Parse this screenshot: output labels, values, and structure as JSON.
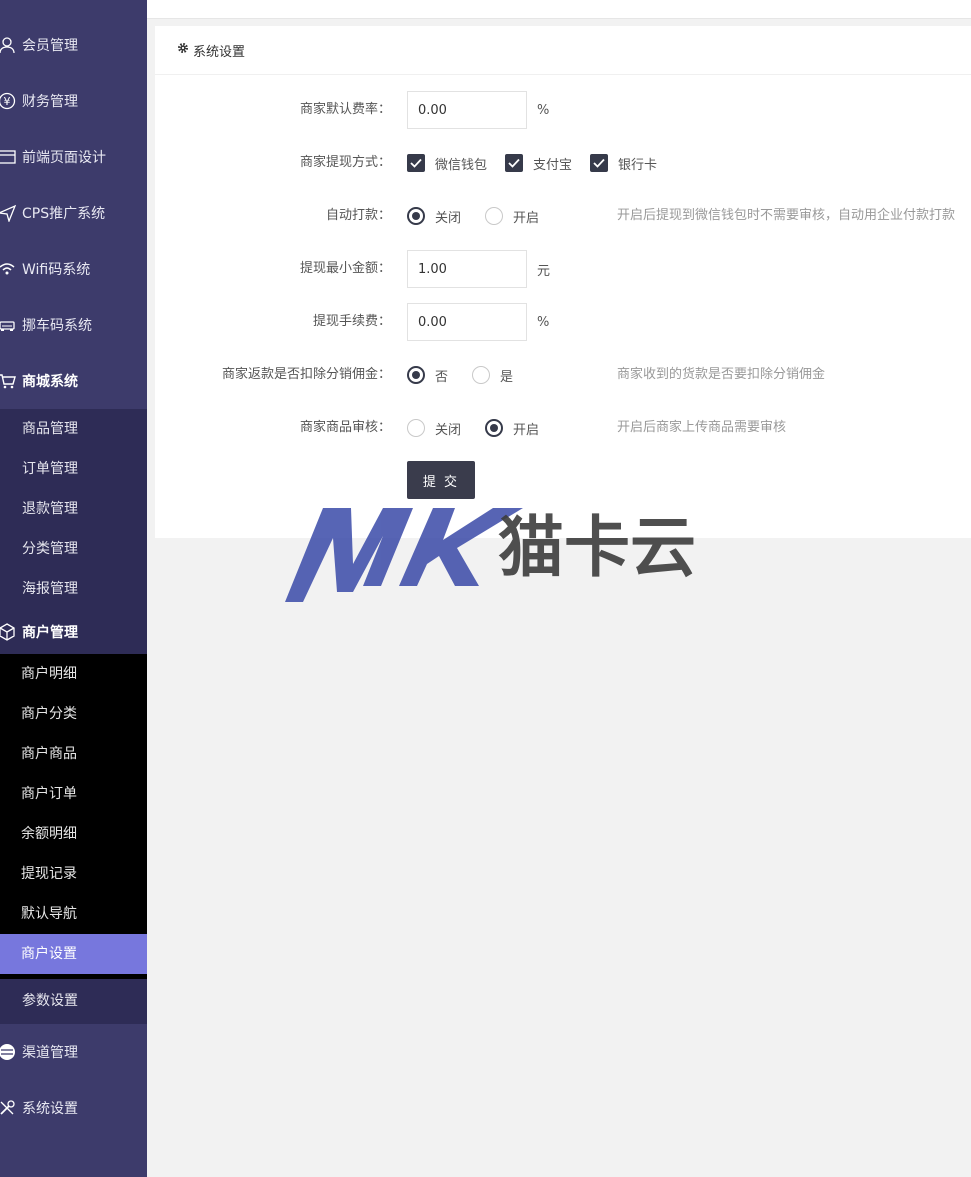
{
  "sidebar": {
    "items": [
      {
        "label": "会员管理",
        "icon": "user-icon"
      },
      {
        "label": "财务管理",
        "icon": "yen-icon"
      },
      {
        "label": "前端页面设计",
        "icon": "layout-icon"
      },
      {
        "label": "CPS推广系统",
        "icon": "send-icon"
      },
      {
        "label": "Wifi码系统",
        "icon": "wifi-icon"
      },
      {
        "label": "挪车码系统",
        "icon": "car-icon"
      },
      {
        "label": "商城系统",
        "icon": "cart-icon"
      }
    ],
    "mall_sub": [
      "商品管理",
      "订单管理",
      "退款管理",
      "分类管理",
      "海报管理"
    ],
    "merchant": {
      "label": "商户管理",
      "icon": "box-icon"
    },
    "merchant_sub": [
      "商户明细",
      "商户分类",
      "商户商品",
      "商户订单",
      "余额明细",
      "提现记录",
      "默认导航",
      "商户设置"
    ],
    "params": "参数设置",
    "bottom": [
      {
        "label": "渠道管理",
        "icon": "channel-icon"
      },
      {
        "label": "系统设置",
        "icon": "tools-icon"
      }
    ]
  },
  "card": {
    "title": "系统设置",
    "fields": {
      "fee_rate": {
        "label": "商家默认费率：",
        "value": "0.00",
        "unit": "%"
      },
      "withdraw_methods": {
        "label": "商家提现方式：",
        "options": [
          "微信钱包",
          "支付宝",
          "银行卡"
        ]
      },
      "auto_pay": {
        "label": "自动打款：",
        "options": [
          "关闭",
          "开启"
        ],
        "selected": "关闭",
        "hint": "开启后提现到微信钱包时不需要审核，自动用企业付款打款"
      },
      "min_amount": {
        "label": "提现最小金额：",
        "value": "1.00",
        "unit": "元"
      },
      "withdraw_fee": {
        "label": "提现手续费：",
        "value": "0.00",
        "unit": "%"
      },
      "deduct_commission": {
        "label": "商家返款是否扣除分销佣金：",
        "options": [
          "否",
          "是"
        ],
        "selected": "否",
        "hint": "商家收到的货款是否要扣除分销佣金"
      },
      "goods_review": {
        "label": "商家商品审核：",
        "options": [
          "关闭",
          "开启"
        ],
        "selected": "开启",
        "hint": "开启后商家上传商品需要审核"
      }
    },
    "submit": "提 交"
  },
  "watermark": {
    "text": "猫卡云",
    "mark": "MK"
  },
  "colors": {
    "sidebar": "#3d3b6b",
    "sidebar_sub": "#2e2c56",
    "active": "#7777dd",
    "dark": "#363a4a"
  }
}
